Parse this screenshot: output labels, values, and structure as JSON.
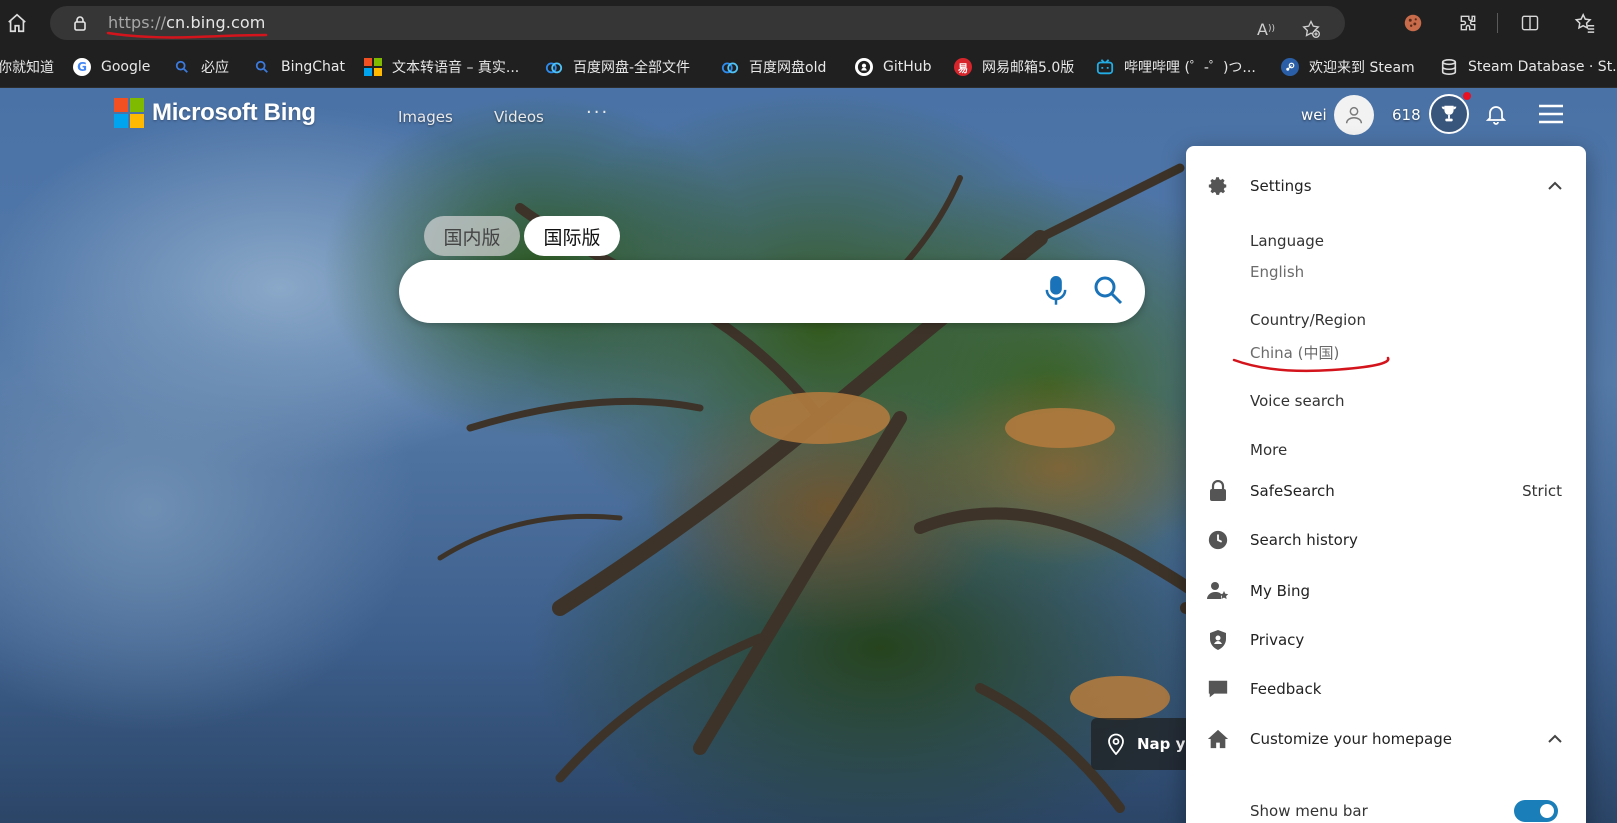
{
  "browser": {
    "url_scheme": "https://",
    "url_host": "cn.bing.com",
    "read_aloud_label": "A"
  },
  "favorites": [
    {
      "label": "你就知道",
      "icon": "generic-icon",
      "color": "#444444"
    },
    {
      "label": "Google",
      "icon": "google-icon",
      "color": "#ffffff"
    },
    {
      "label": "必应",
      "icon": "search-icon",
      "color": "#3b7be0"
    },
    {
      "label": "BingChat",
      "icon": "search-icon",
      "color": "#3b7be0"
    },
    {
      "label": "文本转语音 – 真实...",
      "icon": "microsoft-icon",
      "color": "#f25022"
    },
    {
      "label": "百度网盘-全部文件",
      "icon": "baidu-cloud-icon",
      "color": "#2d8cf0"
    },
    {
      "label": "百度网盘old",
      "icon": "baidu-cloud-icon",
      "color": "#2d8cf0"
    },
    {
      "label": "GitHub",
      "icon": "github-icon",
      "color": "#ffffff"
    },
    {
      "label": "网易邮箱5.0版",
      "icon": "netease-icon",
      "color": "#d6262c"
    },
    {
      "label": "哔哩哔哩 (゜-゜)つ...",
      "icon": "bilibili-icon",
      "color": "#23ade5"
    },
    {
      "label": "欢迎来到 Steam",
      "icon": "steam-icon",
      "color": "#2a5fa8"
    },
    {
      "label": "Steam Database · St...",
      "icon": "database-icon",
      "color": "#dddddd"
    }
  ],
  "bing": {
    "logo_text": "Microsoft Bing",
    "nav": {
      "images": "Images",
      "videos": "Videos",
      "more": "···"
    },
    "user_name": "wei",
    "reward_points": "618",
    "lang_tabs": {
      "domestic": "国内版",
      "international": "国际版"
    },
    "search_placeholder": "",
    "location_label": "Nap y"
  },
  "settings_panel": {
    "settings": "Settings",
    "language_title": "Language",
    "language_value": "English",
    "region_title": "Country/Region",
    "region_value": "China (中国)",
    "voice_search": "Voice search",
    "more": "More",
    "safesearch": "SafeSearch",
    "safesearch_value": "Strict",
    "search_history": "Search history",
    "my_bing": "My Bing",
    "privacy": "Privacy",
    "feedback": "Feedback",
    "customize": "Customize your homepage",
    "show_menu_bar": "Show menu bar",
    "show_menu_bar_on": true
  },
  "colors": {
    "accent": "#1a73b8",
    "annotation": "#d4141c",
    "logo": [
      "#f25022",
      "#7fba00",
      "#00a4ef",
      "#ffb900"
    ]
  }
}
